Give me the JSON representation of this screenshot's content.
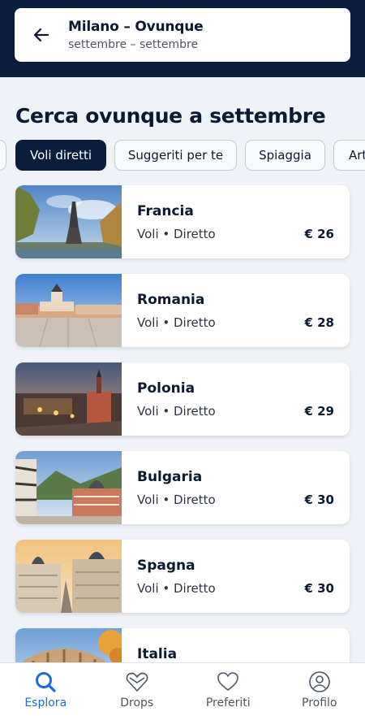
{
  "header": {
    "route": "Milano – Ovunque",
    "dates": "settembre – settembre"
  },
  "page": {
    "title": "Cerca ovunque a settembre"
  },
  "filters": [
    {
      "label": ""
    },
    {
      "label": "Voli diretti",
      "selected": true
    },
    {
      "label": "Suggeriti per te"
    },
    {
      "label": "Spiaggia"
    },
    {
      "label": "Arte"
    }
  ],
  "destinations": [
    {
      "country": "Francia",
      "meta": "Voli • Diretto",
      "price": "€ 26",
      "image": "eiffel-tower-photo"
    },
    {
      "country": "Romania",
      "meta": "Voli • Diretto",
      "price": "€ 28",
      "image": "brasov-square-photo"
    },
    {
      "country": "Polonia",
      "meta": "Voli • Diretto",
      "price": "€ 29",
      "image": "warsaw-night-photo"
    },
    {
      "country": "Bulgaria",
      "meta": "Voli • Diretto",
      "price": "€ 30",
      "image": "rila-monastery-photo"
    },
    {
      "country": "Spagna",
      "meta": "Voli • Diretto",
      "price": "€ 30",
      "image": "madrid-gran-via-photo"
    },
    {
      "country": "Italia",
      "meta": "",
      "price": "",
      "image": "colosseum-photo"
    }
  ],
  "tabbar": {
    "items": [
      {
        "label": "Esplora",
        "icon": "search-icon",
        "active": true
      },
      {
        "label": "Drops",
        "icon": "heart-outline-icon"
      },
      {
        "label": "Preferiti",
        "icon": "heart-icon"
      },
      {
        "label": "Profilo",
        "icon": "profile-icon"
      }
    ]
  },
  "colors": {
    "header_bg": "#0a1d3b",
    "page_bg": "#eff3f8",
    "active_tab": "#1d6ad8",
    "chip_selected_bg": "#0a1d3b"
  }
}
